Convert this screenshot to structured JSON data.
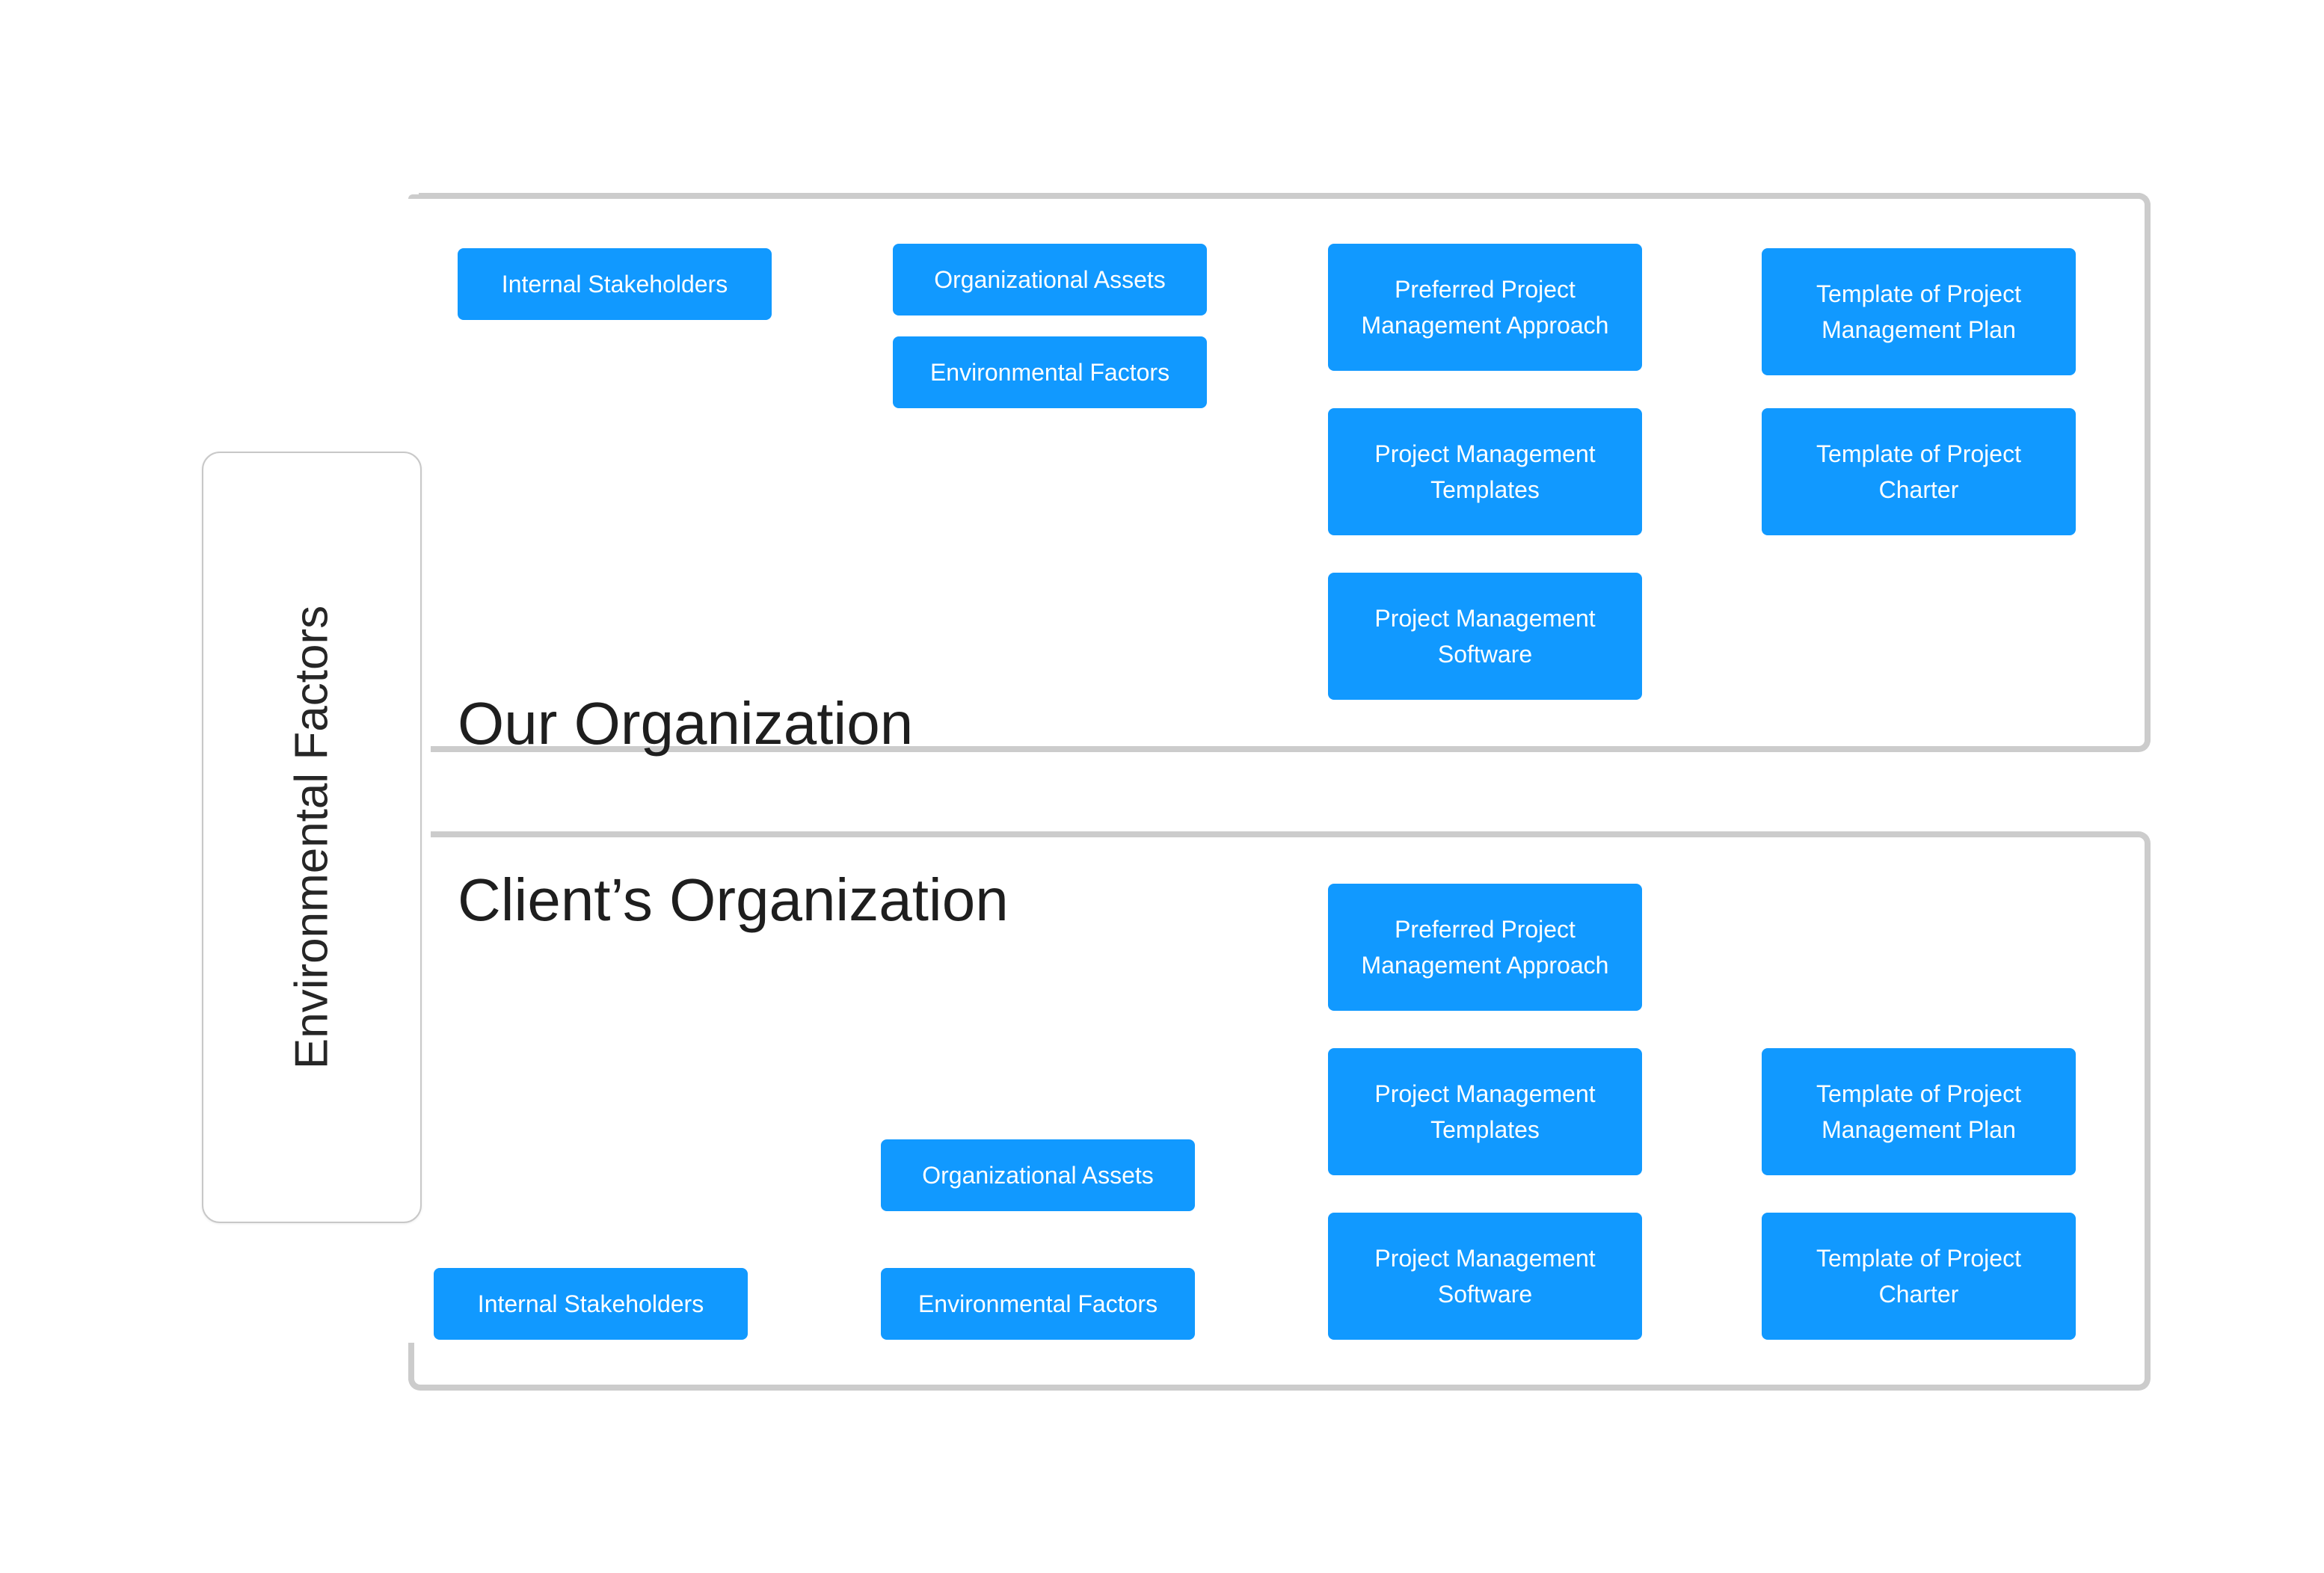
{
  "side_panel": {
    "label": "Environmental Factors"
  },
  "colors": {
    "node_fill": "#1199ff",
    "node_text": "#ffffff",
    "frame": "#cccccc",
    "title_text": "#1e1e1e"
  },
  "our_organization": {
    "title": "Our Organization",
    "nodes": [
      {
        "id": "internal-stakeholders",
        "label": "Internal Stakeholders"
      },
      {
        "id": "organizational-assets",
        "label": "Organizational Assets"
      },
      {
        "id": "environmental-factors",
        "label": "Environmental Factors"
      },
      {
        "id": "preferred-pm-approach",
        "label": "Preferred Project Management Approach"
      },
      {
        "id": "pm-templates",
        "label": "Project Management Templates"
      },
      {
        "id": "pm-software",
        "label": "Project Management Software"
      },
      {
        "id": "template-pm-plan",
        "label": "Template of Project Management Plan"
      },
      {
        "id": "template-project-charter",
        "label": "Template of Project Charter"
      }
    ]
  },
  "clients_organization": {
    "title": "Client’s Organization",
    "nodes": [
      {
        "id": "preferred-pm-approach",
        "label": "Preferred Project Management Approach"
      },
      {
        "id": "pm-templates",
        "label": "Project Management Templates"
      },
      {
        "id": "pm-software",
        "label": "Project Management Software"
      },
      {
        "id": "template-pm-plan",
        "label": "Template of Project Management Plan"
      },
      {
        "id": "template-project-charter",
        "label": "Template of Project Charter"
      },
      {
        "id": "organizational-assets",
        "label": "Organizational Assets"
      },
      {
        "id": "environmental-factors",
        "label": "Environmental Factors"
      },
      {
        "id": "internal-stakeholders",
        "label": "Internal Stakeholders"
      }
    ]
  }
}
